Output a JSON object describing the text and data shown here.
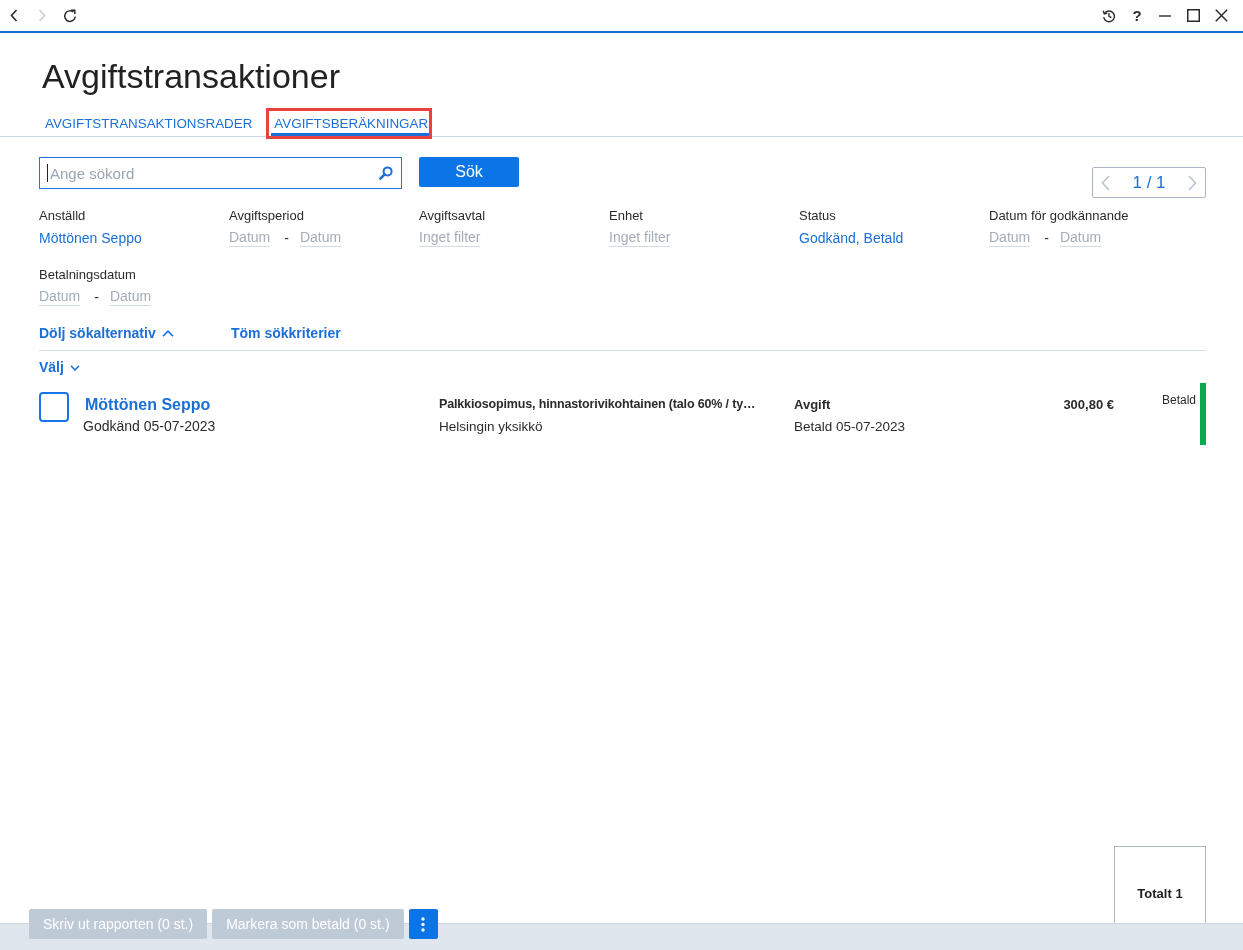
{
  "toolbar": {
    "navigation": [
      {
        "kind": "back",
        "disabled": false
      },
      {
        "kind": "forward",
        "disabled": true
      },
      {
        "kind": "refresh",
        "disabled": false
      }
    ]
  },
  "window_controls": {
    "help_label": "?"
  },
  "page": {
    "title": "Avgiftstransaktioner"
  },
  "tabs": [
    {
      "label": "AVGIFTSTRANSAKTIONSRADER",
      "selected": false,
      "highlighted": false
    },
    {
      "label": "AVGIFTSBERÄKNINGAR",
      "selected": true,
      "highlighted": true
    }
  ],
  "search": {
    "placeholder": "Ange sökord",
    "focused": true,
    "button_label": "Sök"
  },
  "pager": {
    "current": "1 / 1",
    "previous_disabled": true,
    "next_disabled": true
  },
  "filters": [
    {
      "label": "Anställd",
      "kind": "select",
      "value": "Möttönen Seppo"
    },
    {
      "label": "Avgiftsperiod",
      "kind": "date_range",
      "from": {
        "placeholder": "Datum"
      },
      "separator": "-",
      "to": {
        "placeholder": "Datum"
      }
    },
    {
      "label": "Avgiftsavtal",
      "kind": "select",
      "placeholder": "Inget filter"
    },
    {
      "label": "Enhet",
      "kind": "select",
      "placeholder": "Inget filter"
    },
    {
      "label": "Status",
      "kind": "select",
      "value": "Godkänd, Betald"
    },
    {
      "label": "Datum för godkännande",
      "kind": "date_range",
      "from": {
        "placeholder": "Datum"
      },
      "separator": "-",
      "to": {
        "placeholder": "Datum"
      }
    },
    {
      "label": "Betalningsdatum",
      "kind": "date_range",
      "from": {
        "placeholder": "Datum"
      },
      "separator": "-",
      "to": {
        "placeholder": "Datum"
      }
    }
  ],
  "search_options": {
    "toggle_label": "Dölj sökalternativ",
    "expanded": true,
    "clear_label": "Töm sökkriterier"
  },
  "selection": {
    "label": "Välj"
  },
  "rows": [
    {
      "checked": false,
      "employee": "Möttönen Seppo",
      "approval": "Godkänd 05-07-2023",
      "agreement": "Palkkiosopimus, hinnastorivikohtainen (talo 60% / ty…",
      "unit": "Helsingin yksikkö",
      "type": "Avgift",
      "payment": "Betald 05-07-2023",
      "amount": "300,80 €",
      "status": "Betald",
      "color": "#0aa84f"
    }
  ],
  "actions": [
    {
      "label": "Skriv ut rapporten (0 st.)",
      "disabled": true
    },
    {
      "label": "Markera som betald (0 st.)",
      "disabled": true
    }
  ],
  "more_button": {
    "disabled": false
  },
  "totals": {
    "label": "Totalt 1"
  }
}
